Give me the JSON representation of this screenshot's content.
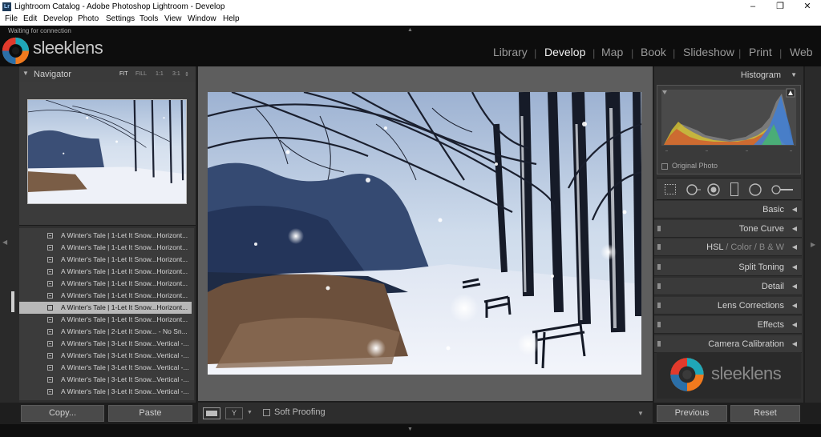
{
  "window": {
    "title": "Lightroom Catalog - Adobe Photoshop Lightroom - Develop",
    "app_icon": "Lr",
    "minimize": "–",
    "maximize": "❐",
    "close": "✕"
  },
  "menu": [
    "File",
    "Edit",
    "Develop",
    "Photo",
    "Settings",
    "Tools",
    "View",
    "Window",
    "Help"
  ],
  "identity": {
    "status": "Waiting for connection",
    "brand": "sleeklens"
  },
  "modules": {
    "items": [
      "Library",
      "Develop",
      "Map",
      "Book",
      "Slideshow",
      "Print",
      "Web"
    ],
    "active": "Develop"
  },
  "navigator": {
    "title": "Navigator",
    "zoom_options": [
      "FIT",
      "FILL",
      "1:1",
      "3:1"
    ],
    "active_zoom": "FIT"
  },
  "filelist": {
    "items": [
      "A Winter's Tale | 1-Let It Snow...Horizont...",
      "A Winter's Tale | 1-Let It Snow...Horizont...",
      "A Winter's Tale | 1-Let It Snow...Horizont...",
      "A Winter's Tale | 1-Let It Snow...Horizont...",
      "A Winter's Tale | 1-Let It Snow...Horizont...",
      "A Winter's Tale | 1-Let It Snow...Horizont...",
      "A Winter's Tale | 1-Let It Snow...Horizont...",
      "A Winter's Tale | 1-Let It Snow...Horizont...",
      "A Winter's Tale | 2-Let It Snow... - No Sn...",
      "A Winter's Tale | 3-Let It Snow...Vertical -...",
      "A Winter's Tale | 3-Let It Snow...Vertical -...",
      "A Winter's Tale | 3-Let It Snow...Vertical -...",
      "A Winter's Tale | 3-Let It Snow...Vertical -...",
      "A Winter's Tale | 3-Let It Snow...Vertical -..."
    ],
    "selected_index": 6
  },
  "left_buttons": {
    "copy": "Copy...",
    "paste": "Paste"
  },
  "toolbar": {
    "soft_proofing": "Soft Proofing"
  },
  "histogram": {
    "title": "Histogram",
    "original_photo": "Original Photo"
  },
  "panels": {
    "basic": "Basic",
    "tone_curve": "Tone Curve",
    "hsl": "HSL",
    "color": "Color",
    "bw": "B & W",
    "split_toning": "Split Toning",
    "detail": "Detail",
    "lens_corrections": "Lens Corrections",
    "effects": "Effects",
    "camera_calibration": "Camera Calibration"
  },
  "right_buttons": {
    "previous": "Previous",
    "reset": "Reset"
  },
  "colors": {
    "accent": "#e8e8e8",
    "logo_orange": "#f07a1e",
    "logo_teal": "#1fa7b8",
    "logo_red": "#e23a2c"
  }
}
